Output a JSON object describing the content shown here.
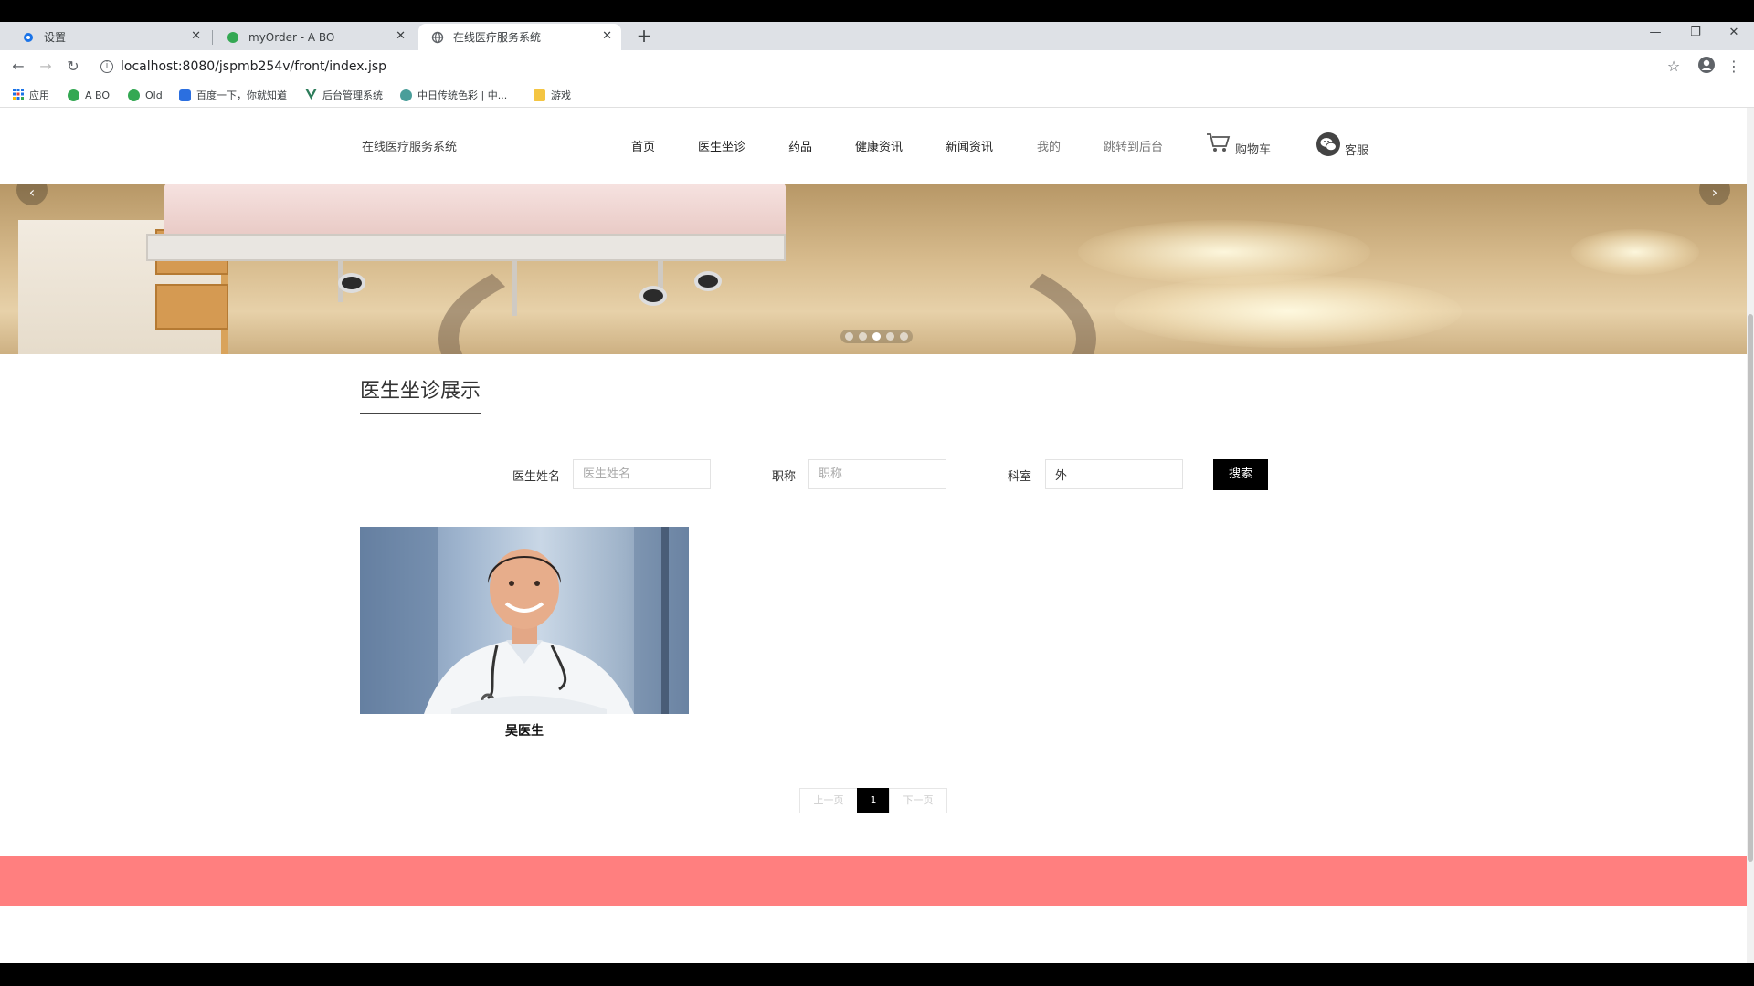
{
  "browser": {
    "tabs": [
      {
        "title": "设置",
        "active": false,
        "icon": "gear-icon"
      },
      {
        "title": "myOrder - A BO",
        "active": false,
        "icon": "app-icon"
      },
      {
        "title": "在线医疗服务系统",
        "active": true,
        "icon": "globe-icon"
      }
    ],
    "url": "localhost:8080/jspmb254v/front/index.jsp",
    "bookmarks": [
      {
        "label": "应用",
        "icon": "apps-grid-icon"
      },
      {
        "label": "A BO",
        "icon": "app-icon"
      },
      {
        "label": "Old",
        "icon": "app-icon"
      },
      {
        "label": "百度一下，你就知道",
        "icon": "baidu-icon"
      },
      {
        "label": "后台管理系统",
        "icon": "vue-icon"
      },
      {
        "label": "中日传统色彩 | 中...",
        "icon": "gear-icon"
      },
      {
        "label": "游戏",
        "icon": "folder-icon"
      }
    ],
    "colors": {
      "tabstrip": "#dee1e6",
      "active_tab": "#ffffff"
    }
  },
  "site": {
    "name": "在线医疗服务系统",
    "nav": [
      "首页",
      "医生坐诊",
      "药品",
      "健康资讯",
      "新闻资讯",
      "我的",
      "跳转到后台"
    ],
    "cart_label": "购物车",
    "service_label": "客服"
  },
  "banner": {
    "slides": 5,
    "active_slide": 3
  },
  "section": {
    "title": "医生坐诊展示"
  },
  "search": {
    "name_label": "医生姓名",
    "name_placeholder": "医生姓名",
    "name_value": "",
    "title_label": "职称",
    "title_placeholder": "职称",
    "title_value": "",
    "dept_label": "科室",
    "dept_value": "外",
    "button_label": "搜索"
  },
  "doctors": [
    {
      "name": "吴医生"
    }
  ],
  "pagination": {
    "prev_label": "上一页",
    "current": "1",
    "next_label": "下一页"
  },
  "colors": {
    "accent": "#000000",
    "footer_band": "#ff7f7f"
  }
}
